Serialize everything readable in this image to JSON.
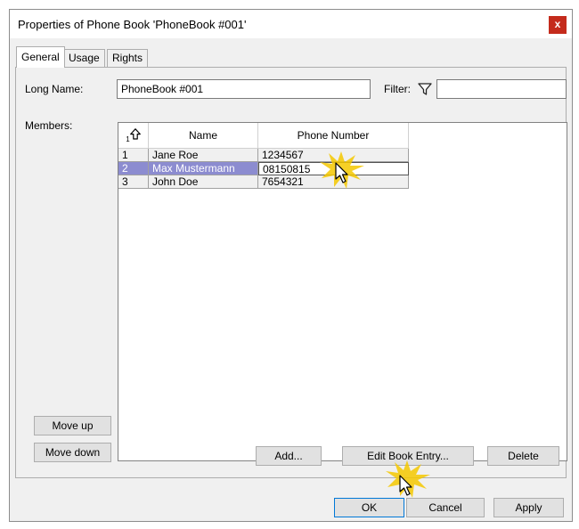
{
  "dialog": {
    "title": "Properties of Phone Book 'PhoneBook #001'",
    "close_glyph": "x"
  },
  "tabs": [
    "General",
    "Usage",
    "Rights"
  ],
  "general": {
    "long_name_label": "Long Name:",
    "long_name_value": "PhoneBook #001",
    "filter_label": "Filter:",
    "filter_value": "",
    "filter_icon": "funnel-icon",
    "members_label": "Members:"
  },
  "members_grid": {
    "sort_indicator": "1",
    "columns": [
      "Name",
      "Phone Number"
    ],
    "rows": [
      {
        "index": "1",
        "name": "Jane Roe",
        "phone": "1234567"
      },
      {
        "index": "2",
        "name": "Max Mustermann",
        "phone": "08150815"
      },
      {
        "index": "3",
        "name": "John Doe",
        "phone": "7654321"
      }
    ],
    "selected_row": 2,
    "selection_color": "#8c8cd0"
  },
  "buttons": {
    "move_up": "Move up",
    "move_down": "Move down",
    "add": "Add...",
    "edit": "Edit Book Entry...",
    "delete": "Delete",
    "ok": "OK",
    "cancel": "Cancel",
    "apply": "Apply"
  },
  "colors": {
    "close_button": "#c42b1c",
    "highlight_burst": "#f5c800"
  }
}
